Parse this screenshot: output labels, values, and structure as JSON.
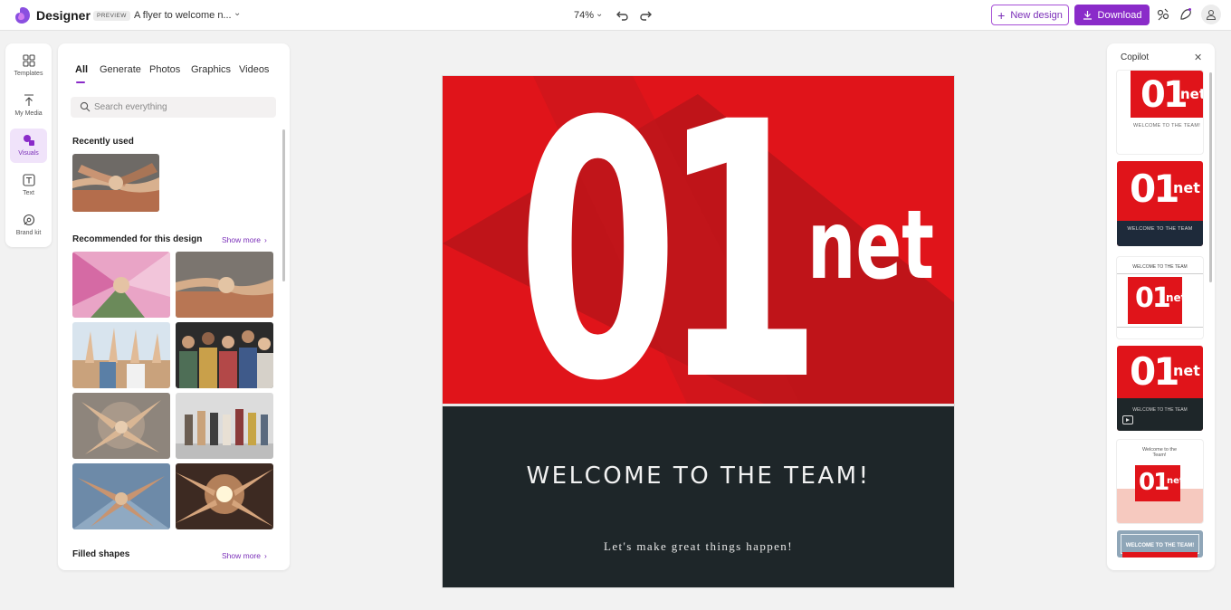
{
  "app": {
    "name": "Designer",
    "badge": "PREVIEW",
    "doc_title": "A flyer to welcome n...",
    "zoom": "74%",
    "new_design_label": "New design",
    "download_label": "Download",
    "colors": {
      "accent": "#8a2bc9",
      "canvas_red": "#e0141a",
      "canvas_dark": "#1e2629"
    }
  },
  "rail": {
    "items": [
      {
        "label": "Templates",
        "icon": "templates-icon"
      },
      {
        "label": "My Media",
        "icon": "upload-icon"
      },
      {
        "label": "Visuals",
        "icon": "visuals-icon",
        "active": true
      },
      {
        "label": "Text",
        "icon": "text-icon"
      },
      {
        "label": "Brand kit",
        "icon": "brand-kit-icon"
      }
    ]
  },
  "panel": {
    "tabs": [
      "All",
      "Generate",
      "Photos",
      "Graphics",
      "Videos"
    ],
    "active_tab": "All",
    "search_placeholder": "Search everything",
    "recently_used_title": "Recently used",
    "recommended_title": "Recommended for this design",
    "show_more": "Show more",
    "filled_shapes_title": "Filled shapes"
  },
  "canvas": {
    "logo_digits": "01",
    "logo_word": "net",
    "headline": "WELCOME TO THE TEAM!",
    "tagline": "Let's make great things happen!"
  },
  "copilot": {
    "title": "Copilot",
    "suggestion_1_text": "WELCOME TO THE TEAM!",
    "suggestion_2_text": "WELCOME TO THE TEAM",
    "suggestion_3_text": "WELCOME TO THE TEAM",
    "suggestion_4_text": "WELCOME TO THE TEAM",
    "suggestion_5_text": "Welcome to the Team!",
    "suggestion_6_text": "WELCOME TO THE TEAM!"
  }
}
